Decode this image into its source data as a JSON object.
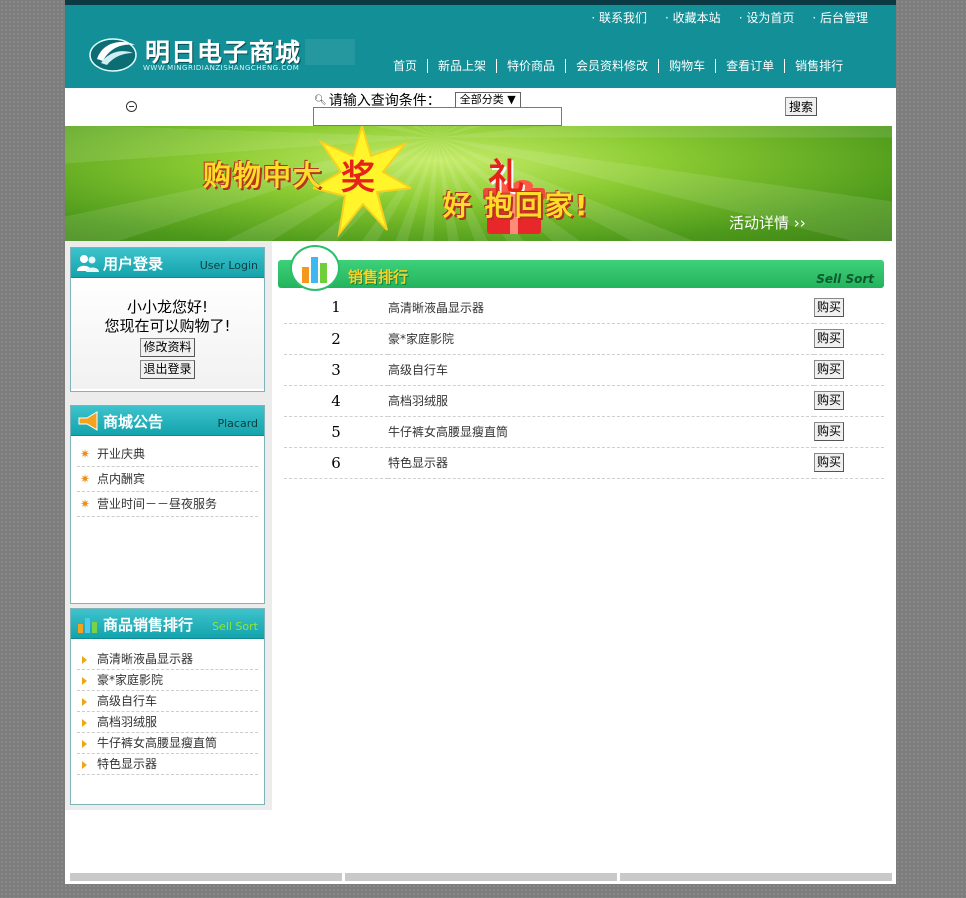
{
  "header": {
    "logo_title": "明日电子商城",
    "logo_sub": "WWW.MINGRIDIANZISHANGCHENG.COM",
    "top_links": [
      "联系我们",
      "收藏本站",
      "设为首页",
      "后台管理"
    ],
    "nav": [
      "首页",
      "新品上架",
      "特价商品",
      "会员资料修改",
      "购物车",
      "查看订单",
      "销售排行"
    ]
  },
  "search": {
    "label": "请输入查询条件：",
    "category": "全部分类 ▼",
    "input_value": "",
    "button": "搜索"
  },
  "banner": {
    "text1": "购物中大",
    "big": "奖",
    "text2": "好   抱回家!",
    "li": "礼",
    "detail": "活动详情 ››"
  },
  "login_box": {
    "title": "用户登录",
    "title_en": "User Login",
    "greeting1": "小小龙您好!",
    "greeting2": "您现在可以购物了!",
    "edit_button": "修改资料",
    "logout_button": "退出登录"
  },
  "notice_box": {
    "title": "商城公告",
    "title_en": "Placard",
    "items": [
      "开业庆典",
      "点内酬宾",
      "营业时间－－昼夜服务"
    ]
  },
  "sort_box": {
    "title": "商品销售排行",
    "title_en": "Sell Sort",
    "items": [
      "高清晰液晶显示器",
      "豪*家庭影院",
      "高级自行车",
      "高档羽绒服",
      "牛仔裤女高腰显瘦直筒",
      "特色显示器"
    ]
  },
  "main": {
    "title": "销售排行",
    "title_en": "Sell Sort",
    "rows": [
      {
        "rank": "1",
        "name": "高清晰液晶显示器",
        "button": "购买"
      },
      {
        "rank": "2",
        "name": "豪*家庭影院",
        "button": "购买"
      },
      {
        "rank": "3",
        "name": "高级自行车",
        "button": "购买"
      },
      {
        "rank": "4",
        "name": "高档羽绒服",
        "button": "购买"
      },
      {
        "rank": "5",
        "name": "牛仔裤女高腰显瘦直筒",
        "button": "购买"
      },
      {
        "rank": "6",
        "name": "特色显示器",
        "button": "购买"
      }
    ]
  },
  "colors": {
    "header_teal": "#128f97",
    "accent_green": "#22b45c",
    "banner_green": "#8ccc33"
  }
}
